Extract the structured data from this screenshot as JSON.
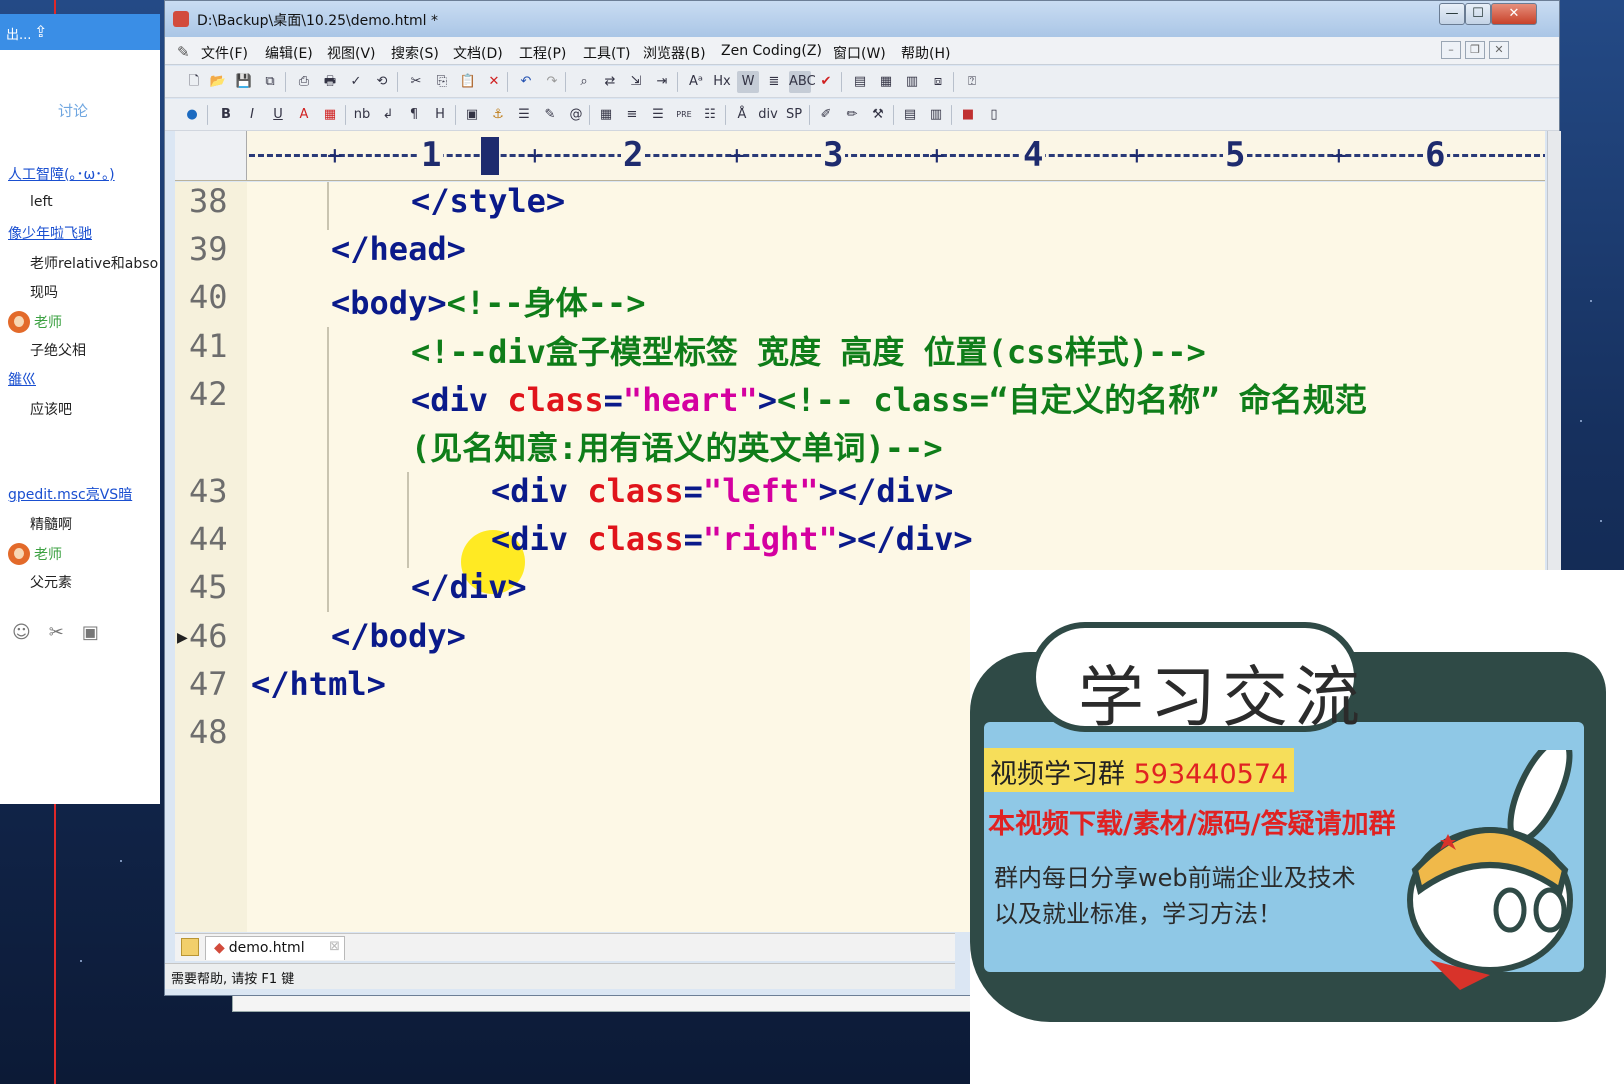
{
  "window": {
    "title": "D:\\Backup\\桌面\\10.25\\demo.html *",
    "min": "—",
    "max": "☐",
    "close": "✕"
  },
  "menu": {
    "items": [
      "文件(F)",
      "编辑(E)",
      "视图(V)",
      "搜索(S)",
      "文档(D)",
      "工程(P)",
      "工具(T)",
      "浏览器(B)",
      "Zen Coding(Z)",
      "窗口(W)",
      "帮助(H)"
    ]
  },
  "toolbar2": {
    "bold": "B",
    "italic": "I",
    "underline": "U",
    "font_color": "A",
    "nb": "nb",
    "br": "↲",
    "para": "¶",
    "heading": "H",
    "div": "div",
    "sp": "SP",
    "pre": "PRE",
    "abc": "ABC"
  },
  "ruler": {
    "numbers": [
      "1",
      "2",
      "3",
      "4",
      "5",
      "6"
    ]
  },
  "code": {
    "line_numbers": [
      "38",
      "39",
      "40",
      "41",
      "42",
      "",
      "43",
      "44",
      "45",
      "46",
      "47",
      "48"
    ],
    "l38": "</style>",
    "l39": "</head>",
    "l40_tag": "<body>",
    "l40_cmt": "<!--身体-->",
    "l41": "<!--div盒子模型标签 宽度 高度 位置(css样式)-->",
    "l42_open": "<div ",
    "l42_attr": "class",
    "l42_eq": "=",
    "l42_val": "\"heart\"",
    "l42_close": ">",
    "l42_cmt": "<!-- class=“自定义的名称” 命名规范",
    "l42b_cmt": "(见名知意:用有语义的英文单词)-->",
    "l43_open": "<div ",
    "l43_attr": "class",
    "l43_eq": "=",
    "l43_val": "\"left\"",
    "l43_close": "></div>",
    "l44_open": "<div ",
    "l44_attr": "class",
    "l44_eq": "=",
    "l44_val": "\"right\"",
    "l44_close": "></div>",
    "l45": "</div>",
    "l46": "</body>",
    "l47": "</html>"
  },
  "tabs": {
    "file": "demo.html",
    "close": "⊠"
  },
  "status": "需要帮助, 请按 F1 键",
  "chat": {
    "top_left": "出...",
    "tab": "讨论",
    "messages": [
      {
        "user": "人工智障(｡･ω･｡)",
        "text": "left"
      },
      {
        "user": "像少年啦飞驰",
        "text": "老师relative和abso"
      },
      {
        "text": "现吗"
      },
      {
        "teacher": "老师",
        "text": "子绝父相"
      },
      {
        "user": "雒巛",
        "text": "应该吧"
      },
      {
        "user": "gpedit.msc亮VS暗",
        "text": "精髓啊"
      },
      {
        "teacher": "老师",
        "text": "父元素"
      }
    ]
  },
  "promo": {
    "heading": "学习交流",
    "group_label": "视频学习群 ",
    "group_number": "593440574",
    "line2": "本视频下载/素材/源码/答疑请加群",
    "line3": "群内每日分享web前端企业及技术",
    "line4": "以及就业标准，学习方法！"
  },
  "colors": {
    "tag": "#0a1a8a",
    "comment": "#0f7d19",
    "attr": "#e0141b",
    "string": "#d400a0",
    "editor_bg": "#fdf8e6"
  }
}
